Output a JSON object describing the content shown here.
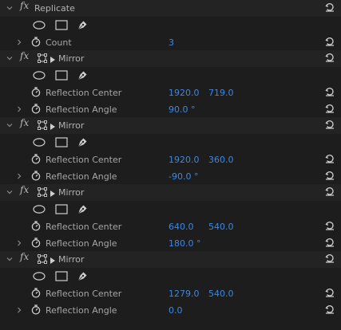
{
  "effects": [
    {
      "type": "replicate",
      "name": "Replicate",
      "params": [
        {
          "label": "Count",
          "values": [
            "3"
          ]
        }
      ]
    },
    {
      "type": "mirror",
      "name": "Mirror",
      "params": [
        {
          "label": "Reflection Center",
          "values": [
            "1920.0",
            "719.0"
          ]
        },
        {
          "label": "Reflection Angle",
          "values": [
            "90.0 °"
          ]
        }
      ]
    },
    {
      "type": "mirror",
      "name": "Mirror",
      "params": [
        {
          "label": "Reflection Center",
          "values": [
            "1920.0",
            "360.0"
          ]
        },
        {
          "label": "Reflection Angle",
          "values": [
            "-90.0 °"
          ]
        }
      ]
    },
    {
      "type": "mirror",
      "name": "Mirror",
      "params": [
        {
          "label": "Reflection Center",
          "values": [
            "640.0",
            "540.0"
          ]
        },
        {
          "label": "Reflection Angle",
          "values": [
            "180.0 °"
          ]
        }
      ]
    },
    {
      "type": "mirror",
      "name": "Mirror",
      "params": [
        {
          "label": "Reflection Center",
          "values": [
            "1279.0",
            "540.0"
          ]
        },
        {
          "label": "Reflection Angle",
          "values": [
            "0.0"
          ]
        }
      ]
    }
  ],
  "fx_label": "fx",
  "icons": {
    "expand": "chevron-down-icon",
    "collapse": "chevron-right-icon",
    "ellipse": "ellipse-mask-icon",
    "rectangle": "rectangle-mask-icon",
    "pen": "pen-mask-icon",
    "stopwatch": "stopwatch-icon",
    "reset": "reset-icon",
    "transform": "transform-icon"
  },
  "colors": {
    "value_blue": "#3f87e0",
    "background": "#1d1d1d"
  }
}
